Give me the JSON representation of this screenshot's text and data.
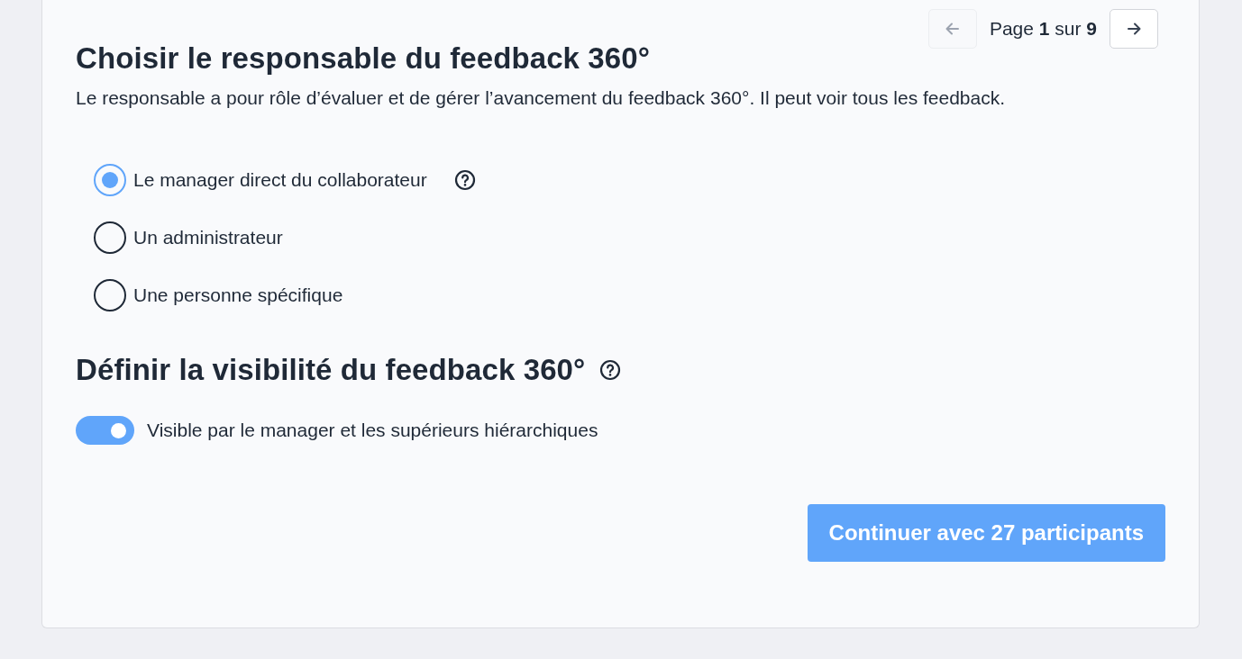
{
  "pagination": {
    "previous": {
      "disabled": true
    },
    "label": "Page **1** sur **9**",
    "next": {
      "disabled": false
    }
  },
  "responsible": {
    "title": "Choisir le responsable du feedback 360°",
    "description": "Le responsable a pour rôle d’évaluer et de gérer l’avancement du feedback 360°. Il peut voir tous les feedback.",
    "options": [
      {
        "label": "Le manager direct du collaborateur",
        "selected": true,
        "help": true
      },
      {
        "label": "Un administrateur",
        "selected": false,
        "help": false
      },
      {
        "label": "Une personne spécifique",
        "selected": false,
        "help": false
      }
    ]
  },
  "visibility": {
    "title": "Définir la visibilité du feedback 360°",
    "help": true,
    "toggle": {
      "label": "Visible par le manager et les supérieurs hiérarchiques",
      "on": true
    }
  },
  "submit": {
    "label": "Continuer avec 27 participants"
  }
}
